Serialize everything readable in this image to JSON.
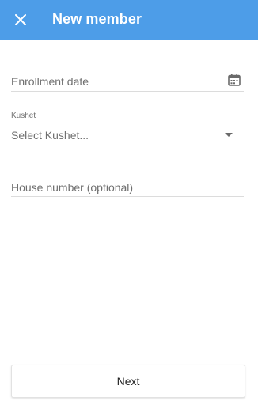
{
  "appbar": {
    "title": "New member",
    "close_icon": "close-icon",
    "color": "#4d9de8"
  },
  "form": {
    "enrollment_date": {
      "placeholder": "Enrollment date",
      "icon": "calendar-icon"
    },
    "kushet": {
      "label": "Kushet",
      "placeholder": "Select Kushet...",
      "icon": "dropdown-arrow-icon"
    },
    "house_number": {
      "placeholder": "House number (optional)"
    }
  },
  "footer": {
    "next_label": "Next"
  }
}
